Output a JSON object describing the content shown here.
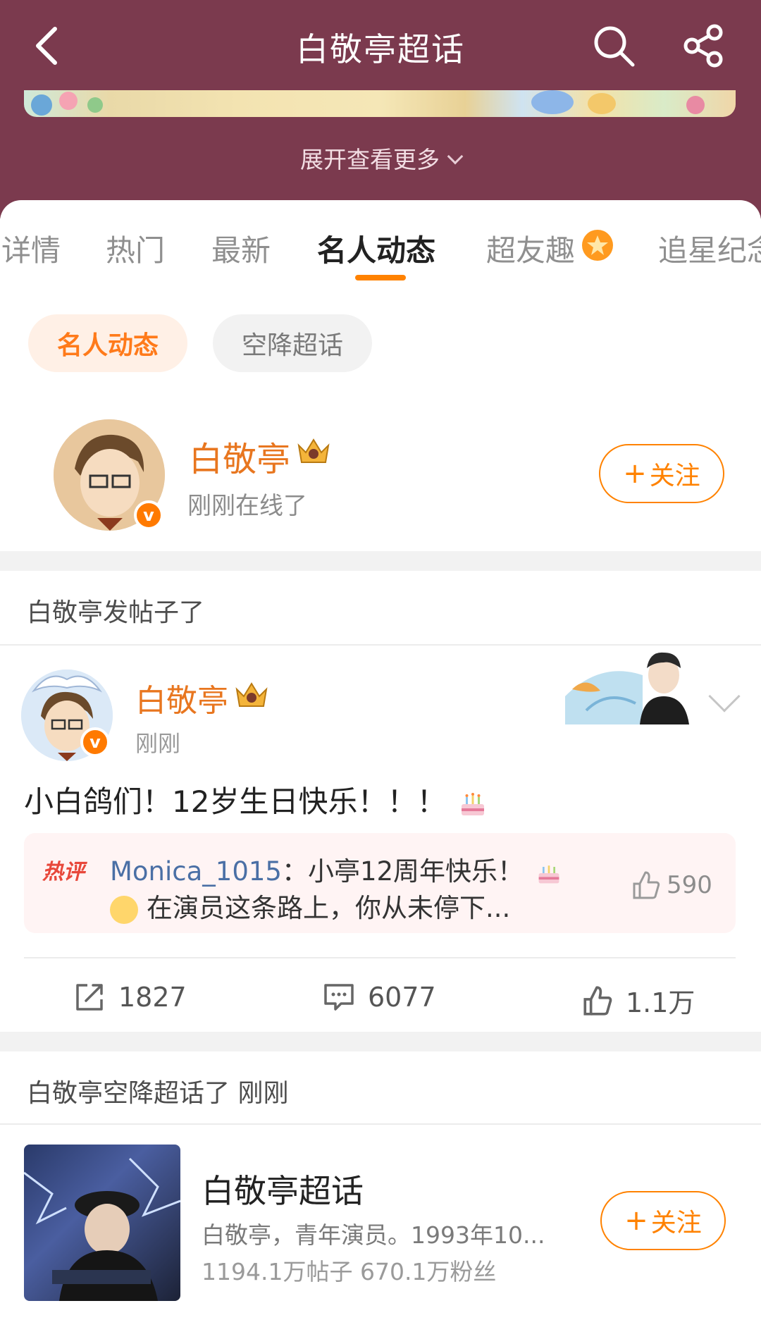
{
  "header": {
    "title": "白敬亭超话",
    "expand_label": "展开查看更多",
    "bg_color": "#7b3a4e"
  },
  "tabs": [
    {
      "label": "详情"
    },
    {
      "label": "热门"
    },
    {
      "label": "最新"
    },
    {
      "label": "名人动态",
      "active": true
    },
    {
      "label": "超友趣"
    },
    {
      "label": "追星纪念"
    }
  ],
  "filters": [
    {
      "label": "名人动态",
      "active": true
    },
    {
      "label": "空降超话"
    }
  ],
  "celebrity": {
    "name": "白敬亭",
    "status": "刚刚在线了",
    "follow_label": "关注",
    "accent": "#ff8200"
  },
  "post_section": {
    "label": "白敬亭发帖子了"
  },
  "post": {
    "author": "白敬亭",
    "time": "刚刚",
    "text": "小白鸽们！12岁生日快乐！！！",
    "hot_comment": {
      "tag": "热评",
      "user": "Monica_1015",
      "line1": "：小亭12周年快乐！",
      "line2": "在演员这条路上，你从未停下...",
      "likes": "590"
    },
    "actions": {
      "reposts": "1827",
      "comments": "6077",
      "likes": "1.1万"
    }
  },
  "topic_section": {
    "label": "白敬亭空降超话了 刚刚"
  },
  "topic": {
    "title": "白敬亭超话",
    "desc": "白敬亭，青年演员。1993年10...",
    "stats": "1194.1万帖子  670.1万粉丝",
    "follow_label": "关注"
  }
}
